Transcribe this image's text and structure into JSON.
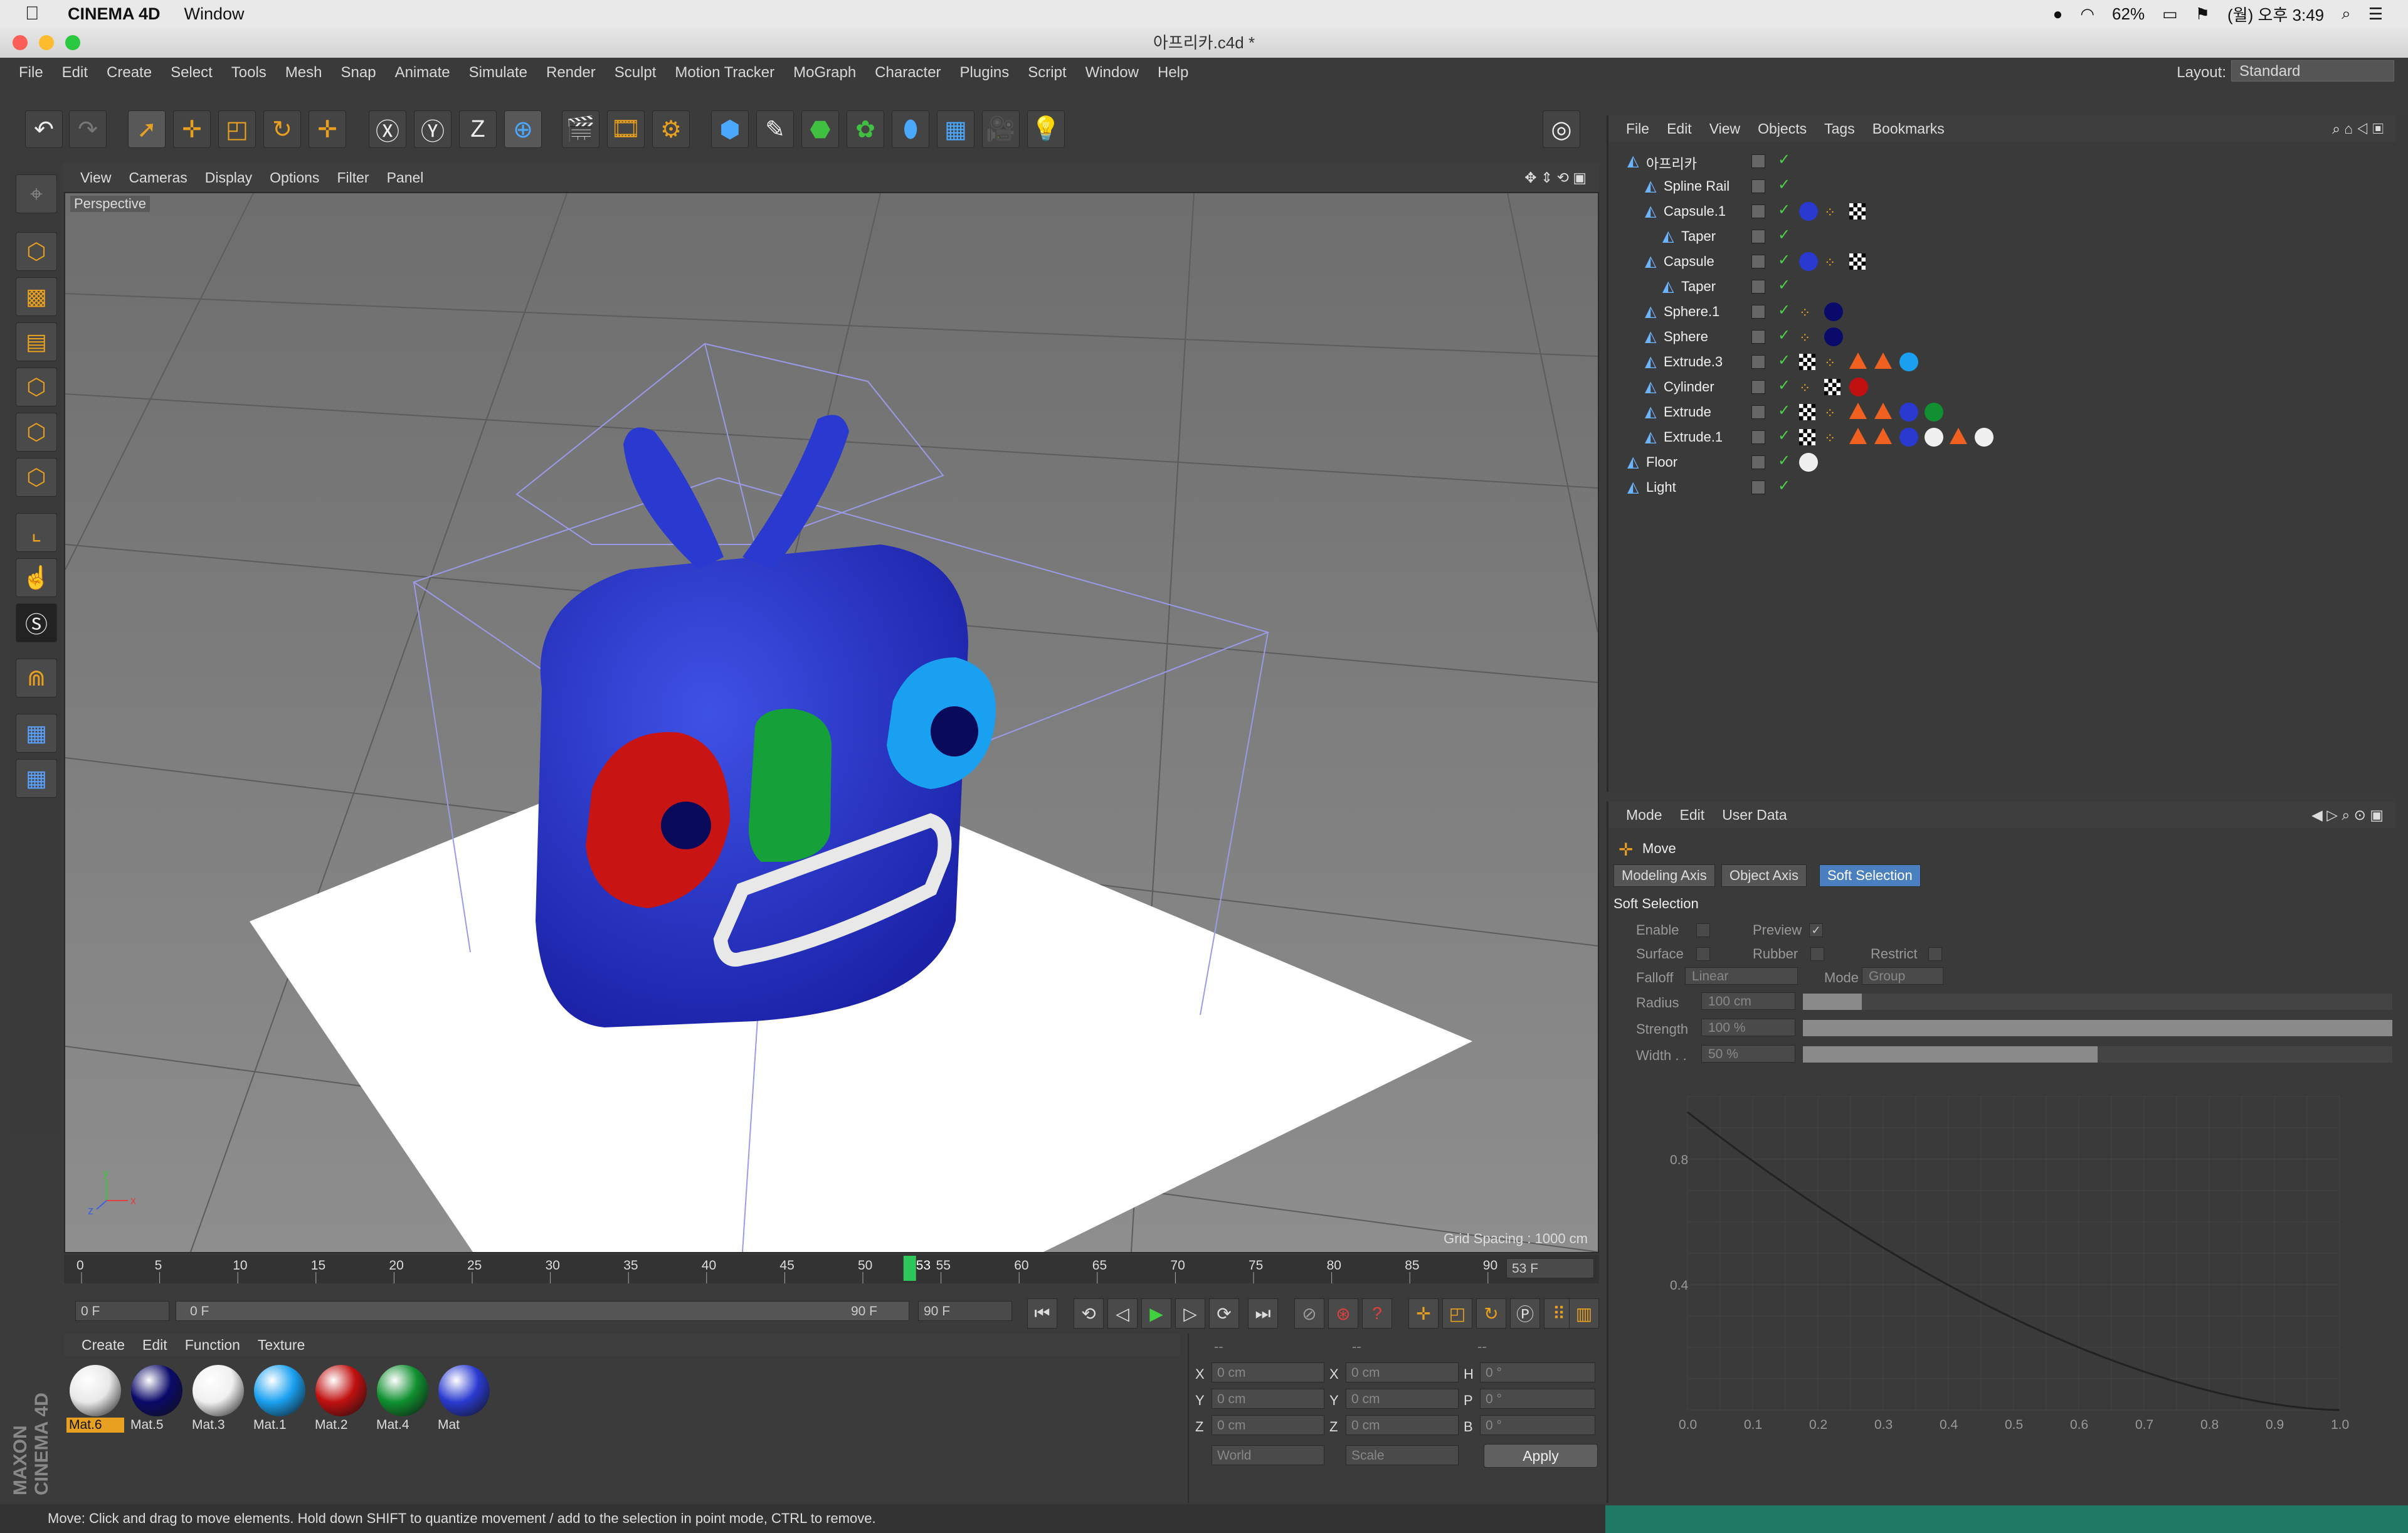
{
  "os_menubar": {
    "app": "CINEMA 4D",
    "menu": "Window",
    "battery": "62%",
    "clock": "(월) 오후 3:49"
  },
  "window": {
    "title": "아프리카.c4d *"
  },
  "app_menu": [
    "File",
    "Edit",
    "Create",
    "Select",
    "Tools",
    "Mesh",
    "Snap",
    "Animate",
    "Simulate",
    "Render",
    "Sculpt",
    "Motion Tracker",
    "MoGraph",
    "Character",
    "Plugins",
    "Script",
    "Window",
    "Help"
  ],
  "layout": {
    "label": "Layout:",
    "value": "Standard"
  },
  "viewport": {
    "menu": [
      "View",
      "Cameras",
      "Display",
      "Options",
      "Filter",
      "Panel"
    ],
    "label": "Perspective",
    "grid_spacing": "Grid Spacing : 1000 cm"
  },
  "timeline": {
    "ticks": [
      "0",
      "5",
      "10",
      "15",
      "20",
      "25",
      "30",
      "35",
      "40",
      "45",
      "50",
      "55",
      "60",
      "65",
      "70",
      "75",
      "80",
      "85",
      "90"
    ],
    "current": "53",
    "current_field": "53 F",
    "start": "0 F",
    "range_start": "0 F",
    "range_end": "90 F",
    "end": "90 F"
  },
  "materials": {
    "menu": [
      "Create",
      "Edit",
      "Function",
      "Texture"
    ],
    "items": [
      {
        "name": "Mat.6",
        "color": "#e8e8e8"
      },
      {
        "name": "Mat.5",
        "color": "#0a0a6a"
      },
      {
        "name": "Mat.3",
        "color": "#f0f0f0"
      },
      {
        "name": "Mat.1",
        "color": "#1aa0f0"
      },
      {
        "name": "Mat.2",
        "color": "#c01010"
      },
      {
        "name": "Mat.4",
        "color": "#109030"
      },
      {
        "name": "Mat",
        "color": "#2a3ad0"
      }
    ]
  },
  "coords": {
    "headers": [
      "--",
      "--",
      "--"
    ],
    "rows": [
      {
        "a": "X",
        "av": "0 cm",
        "b": "X",
        "bv": "0 cm",
        "c": "H",
        "cv": "0 °"
      },
      {
        "a": "Y",
        "av": "0 cm",
        "b": "Y",
        "bv": "0 cm",
        "c": "P",
        "cv": "0 °"
      },
      {
        "a": "Z",
        "av": "0 cm",
        "b": "Z",
        "bv": "0 cm",
        "c": "B",
        "cv": "0 °"
      }
    ],
    "space": "World",
    "mode": "Scale",
    "apply": "Apply"
  },
  "status": "Move: Click and drag to move elements. Hold down SHIFT to quantize movement / add to the selection in point mode, CTRL to remove.",
  "brand": "MAXON CINEMA 4D",
  "objects": {
    "menu": [
      "File",
      "Edit",
      "View",
      "Objects",
      "Tags",
      "Bookmarks"
    ],
    "items": [
      {
        "name": "아프리카",
        "indent": 0
      },
      {
        "name": "Spline Rail",
        "indent": 1
      },
      {
        "name": "Capsule.1",
        "indent": 1
      },
      {
        "name": "Taper",
        "indent": 2
      },
      {
        "name": "Capsule",
        "indent": 1
      },
      {
        "name": "Taper",
        "indent": 2
      },
      {
        "name": "Sphere.1",
        "indent": 1
      },
      {
        "name": "Sphere",
        "indent": 1
      },
      {
        "name": "Extrude.3",
        "indent": 1
      },
      {
        "name": "Cylinder",
        "indent": 1
      },
      {
        "name": "Extrude",
        "indent": 1
      },
      {
        "name": "Extrude.1",
        "indent": 1
      },
      {
        "name": "Floor",
        "indent": 0
      },
      {
        "name": "Light",
        "indent": 0
      }
    ]
  },
  "attributes": {
    "menu": [
      "Mode",
      "Edit",
      "User Data"
    ],
    "tool": "Move",
    "tabs": [
      "Modeling Axis",
      "Object Axis",
      "Soft Selection"
    ],
    "section": "Soft Selection",
    "enable": "Enable",
    "preview": "Preview",
    "surface": "Surface",
    "rubber": "Rubber",
    "restrict": "Restrict",
    "falloff_label": "Falloff",
    "falloff": "Linear",
    "mode_label": "Mode",
    "mode": "Group",
    "radius_label": "Radius",
    "radius": "100 cm",
    "strength_label": "Strength",
    "strength": "100 %",
    "width_label": "Width . .",
    "width": "50 %",
    "graph_y": [
      "0.8",
      "0.4"
    ],
    "graph_x": [
      "0.0",
      "0.1",
      "0.2",
      "0.3",
      "0.4",
      "0.5",
      "0.6",
      "0.7",
      "0.8",
      "0.9",
      "1.0"
    ]
  }
}
